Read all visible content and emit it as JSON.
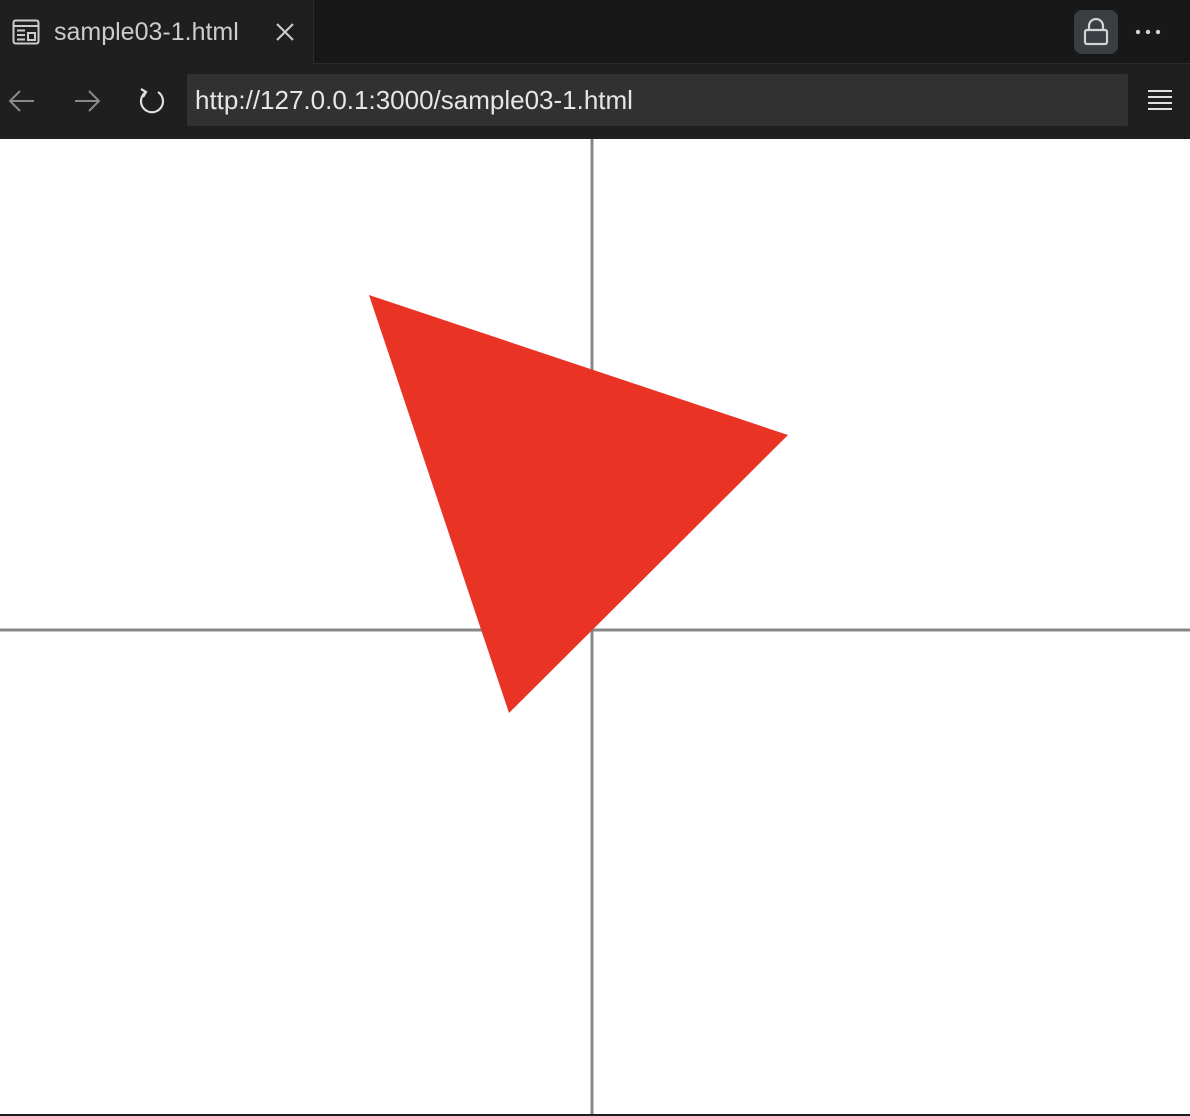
{
  "tab": {
    "title": "sample03-1.html",
    "icon": "preview-icon",
    "close_icon": "close-icon"
  },
  "toolbar": {
    "back_icon": "arrow-left-icon",
    "forward_icon": "arrow-right-icon",
    "reload_icon": "reload-icon",
    "url": "http://127.0.0.1:3000/sample03-1.html",
    "menu_icon": "hamburger-menu-icon",
    "lock_icon": "lock-icon",
    "more_icon": "ellipsis-icon"
  },
  "canvas": {
    "background": "#ffffff",
    "axis_color": "#888888",
    "shape": "triangle",
    "shape_color": "#e83325"
  },
  "colors": {
    "chrome_dark": "#181818",
    "tab_active": "#1f1f1f",
    "url_bg": "#313131",
    "text": "#cccccc"
  }
}
